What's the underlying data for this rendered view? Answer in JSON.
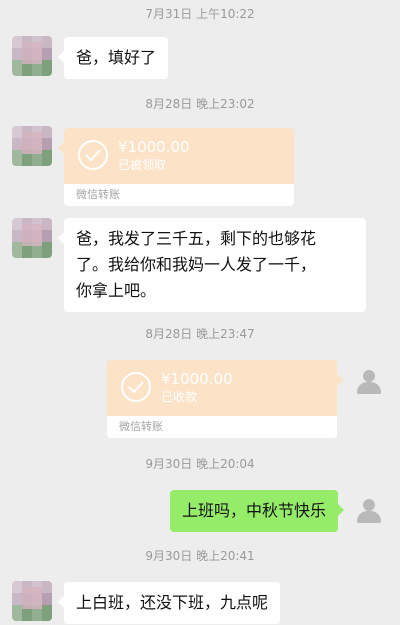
{
  "messages": {
    "ts1": "7月31日 上午10:22",
    "msg1": "爸，填好了",
    "ts2": "8月28日 晚上23:02",
    "transfer1": {
      "amount": "¥1000.00",
      "status": "已被领取",
      "label": "微信转账"
    },
    "msg2_line1": "爸，我发了三千五，剩下的也够花",
    "msg2_line2": "了。我给你和我妈一人发了一千，",
    "msg2_line3": "你拿上吧。",
    "ts3": "8月28日 晚上23:47",
    "transfer2": {
      "amount": "¥1000.00",
      "status": "已收款",
      "label": "微信转账"
    },
    "ts4": "9月30日 晚上20:04",
    "msg3": "上班吗，中秋节快乐",
    "ts5": "9月30日 晚上20:41",
    "msg4": "上白班，还没下班，九点呢"
  },
  "colors": {
    "background": "#ededed",
    "bubble_left": "#ffffff",
    "bubble_right": "#95ec69",
    "transfer": "#fce2c6"
  },
  "icons": {
    "contact_avatar": "blurred-photo-avatar",
    "self_avatar": "gray-person-icon",
    "transfer_check": "check-circle-icon"
  }
}
